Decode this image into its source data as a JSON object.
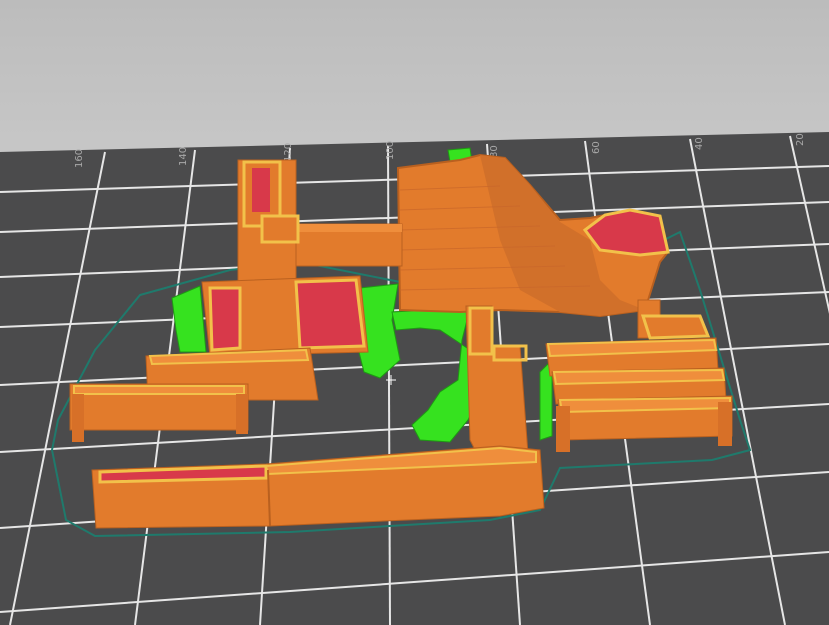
{
  "window": {
    "title": ""
  },
  "viewport": {
    "background": "#c4c4c4",
    "bed_color": "#4c4c4d",
    "grid_color": "#e8e8e8",
    "axis_tick_labels": [
      "160",
      "140",
      "120",
      "100",
      "80",
      "60",
      "40",
      "20"
    ]
  },
  "preview": {
    "colors": {
      "perimeter": "#e07b2c",
      "perimeter_dark": "#b9601f",
      "inner_outline": "#f2c14a",
      "infill": "#d8394a",
      "support": "#35e220",
      "skirt": "#1f7a6c"
    }
  }
}
